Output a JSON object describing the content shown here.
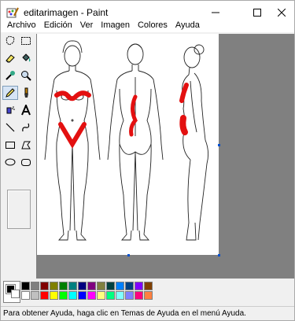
{
  "window": {
    "title": "editarimagen - Paint"
  },
  "menu": {
    "archivo": "Archivo",
    "edicion": "Edición",
    "ver": "Ver",
    "imagen": "Imagen",
    "colores": "Colores",
    "ayuda": "Ayuda"
  },
  "tools": [
    {
      "name": "free-form-select-icon"
    },
    {
      "name": "rect-select-icon"
    },
    {
      "name": "eraser-icon"
    },
    {
      "name": "fill-bucket-icon"
    },
    {
      "name": "pick-color-icon"
    },
    {
      "name": "magnifier-icon"
    },
    {
      "name": "pencil-icon",
      "selected": true
    },
    {
      "name": "brush-icon"
    },
    {
      "name": "airbrush-icon"
    },
    {
      "name": "text-icon"
    },
    {
      "name": "line-icon"
    },
    {
      "name": "curve-icon"
    },
    {
      "name": "rectangle-icon"
    },
    {
      "name": "polygon-icon"
    },
    {
      "name": "ellipse-icon"
    },
    {
      "name": "rounded-rectangle-icon"
    }
  ],
  "palette": {
    "foreground": "#000000",
    "background": "#ffffff",
    "colors": [
      "#000000",
      "#808080",
      "#800000",
      "#808000",
      "#008000",
      "#008080",
      "#000080",
      "#800080",
      "#808040",
      "#004040",
      "#0080ff",
      "#004080",
      "#8000ff",
      "#804000",
      "#ffffff",
      "#c0c0c0",
      "#ff0000",
      "#ffff00",
      "#00ff00",
      "#00ffff",
      "#0000ff",
      "#ff00ff",
      "#ffff80",
      "#00ff80",
      "#80ffff",
      "#8080ff",
      "#ff0080",
      "#ff8040"
    ]
  },
  "status": {
    "text": "Para obtener Ayuda, haga clic en Temas de Ayuda en el menú Ayuda."
  },
  "colors": {
    "mark": "#e31010",
    "canvas_bg": "#808080"
  }
}
